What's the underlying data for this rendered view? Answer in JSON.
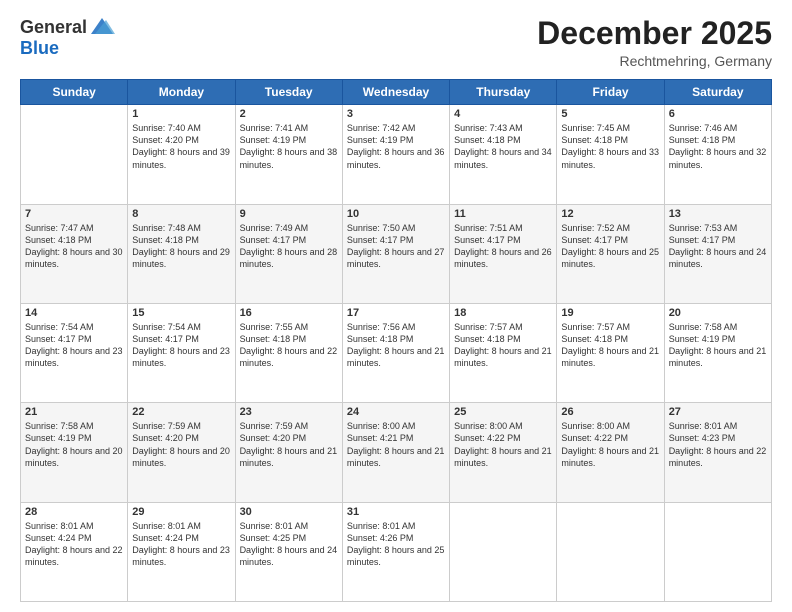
{
  "header": {
    "logo_general": "General",
    "logo_blue": "Blue",
    "month": "December 2025",
    "location": "Rechtmehring, Germany"
  },
  "days_of_week": [
    "Sunday",
    "Monday",
    "Tuesday",
    "Wednesday",
    "Thursday",
    "Friday",
    "Saturday"
  ],
  "weeks": [
    [
      {
        "day": "",
        "empty": true
      },
      {
        "day": "1",
        "sunrise": "Sunrise: 7:40 AM",
        "sunset": "Sunset: 4:20 PM",
        "daylight": "Daylight: 8 hours and 39 minutes."
      },
      {
        "day": "2",
        "sunrise": "Sunrise: 7:41 AM",
        "sunset": "Sunset: 4:19 PM",
        "daylight": "Daylight: 8 hours and 38 minutes."
      },
      {
        "day": "3",
        "sunrise": "Sunrise: 7:42 AM",
        "sunset": "Sunset: 4:19 PM",
        "daylight": "Daylight: 8 hours and 36 minutes."
      },
      {
        "day": "4",
        "sunrise": "Sunrise: 7:43 AM",
        "sunset": "Sunset: 4:18 PM",
        "daylight": "Daylight: 8 hours and 34 minutes."
      },
      {
        "day": "5",
        "sunrise": "Sunrise: 7:45 AM",
        "sunset": "Sunset: 4:18 PM",
        "daylight": "Daylight: 8 hours and 33 minutes."
      },
      {
        "day": "6",
        "sunrise": "Sunrise: 7:46 AM",
        "sunset": "Sunset: 4:18 PM",
        "daylight": "Daylight: 8 hours and 32 minutes."
      }
    ],
    [
      {
        "day": "7",
        "sunrise": "Sunrise: 7:47 AM",
        "sunset": "Sunset: 4:18 PM",
        "daylight": "Daylight: 8 hours and 30 minutes."
      },
      {
        "day": "8",
        "sunrise": "Sunrise: 7:48 AM",
        "sunset": "Sunset: 4:18 PM",
        "daylight": "Daylight: 8 hours and 29 minutes."
      },
      {
        "day": "9",
        "sunrise": "Sunrise: 7:49 AM",
        "sunset": "Sunset: 4:17 PM",
        "daylight": "Daylight: 8 hours and 28 minutes."
      },
      {
        "day": "10",
        "sunrise": "Sunrise: 7:50 AM",
        "sunset": "Sunset: 4:17 PM",
        "daylight": "Daylight: 8 hours and 27 minutes."
      },
      {
        "day": "11",
        "sunrise": "Sunrise: 7:51 AM",
        "sunset": "Sunset: 4:17 PM",
        "daylight": "Daylight: 8 hours and 26 minutes."
      },
      {
        "day": "12",
        "sunrise": "Sunrise: 7:52 AM",
        "sunset": "Sunset: 4:17 PM",
        "daylight": "Daylight: 8 hours and 25 minutes."
      },
      {
        "day": "13",
        "sunrise": "Sunrise: 7:53 AM",
        "sunset": "Sunset: 4:17 PM",
        "daylight": "Daylight: 8 hours and 24 minutes."
      }
    ],
    [
      {
        "day": "14",
        "sunrise": "Sunrise: 7:54 AM",
        "sunset": "Sunset: 4:17 PM",
        "daylight": "Daylight: 8 hours and 23 minutes."
      },
      {
        "day": "15",
        "sunrise": "Sunrise: 7:54 AM",
        "sunset": "Sunset: 4:17 PM",
        "daylight": "Daylight: 8 hours and 23 minutes."
      },
      {
        "day": "16",
        "sunrise": "Sunrise: 7:55 AM",
        "sunset": "Sunset: 4:18 PM",
        "daylight": "Daylight: 8 hours and 22 minutes."
      },
      {
        "day": "17",
        "sunrise": "Sunrise: 7:56 AM",
        "sunset": "Sunset: 4:18 PM",
        "daylight": "Daylight: 8 hours and 21 minutes."
      },
      {
        "day": "18",
        "sunrise": "Sunrise: 7:57 AM",
        "sunset": "Sunset: 4:18 PM",
        "daylight": "Daylight: 8 hours and 21 minutes."
      },
      {
        "day": "19",
        "sunrise": "Sunrise: 7:57 AM",
        "sunset": "Sunset: 4:18 PM",
        "daylight": "Daylight: 8 hours and 21 minutes."
      },
      {
        "day": "20",
        "sunrise": "Sunrise: 7:58 AM",
        "sunset": "Sunset: 4:19 PM",
        "daylight": "Daylight: 8 hours and 21 minutes."
      }
    ],
    [
      {
        "day": "21",
        "sunrise": "Sunrise: 7:58 AM",
        "sunset": "Sunset: 4:19 PM",
        "daylight": "Daylight: 8 hours and 20 minutes."
      },
      {
        "day": "22",
        "sunrise": "Sunrise: 7:59 AM",
        "sunset": "Sunset: 4:20 PM",
        "daylight": "Daylight: 8 hours and 20 minutes."
      },
      {
        "day": "23",
        "sunrise": "Sunrise: 7:59 AM",
        "sunset": "Sunset: 4:20 PM",
        "daylight": "Daylight: 8 hours and 21 minutes."
      },
      {
        "day": "24",
        "sunrise": "Sunrise: 8:00 AM",
        "sunset": "Sunset: 4:21 PM",
        "daylight": "Daylight: 8 hours and 21 minutes."
      },
      {
        "day": "25",
        "sunrise": "Sunrise: 8:00 AM",
        "sunset": "Sunset: 4:22 PM",
        "daylight": "Daylight: 8 hours and 21 minutes."
      },
      {
        "day": "26",
        "sunrise": "Sunrise: 8:00 AM",
        "sunset": "Sunset: 4:22 PM",
        "daylight": "Daylight: 8 hours and 21 minutes."
      },
      {
        "day": "27",
        "sunrise": "Sunrise: 8:01 AM",
        "sunset": "Sunset: 4:23 PM",
        "daylight": "Daylight: 8 hours and 22 minutes."
      }
    ],
    [
      {
        "day": "28",
        "sunrise": "Sunrise: 8:01 AM",
        "sunset": "Sunset: 4:24 PM",
        "daylight": "Daylight: 8 hours and 22 minutes."
      },
      {
        "day": "29",
        "sunrise": "Sunrise: 8:01 AM",
        "sunset": "Sunset: 4:24 PM",
        "daylight": "Daylight: 8 hours and 23 minutes."
      },
      {
        "day": "30",
        "sunrise": "Sunrise: 8:01 AM",
        "sunset": "Sunset: 4:25 PM",
        "daylight": "Daylight: 8 hours and 24 minutes."
      },
      {
        "day": "31",
        "sunrise": "Sunrise: 8:01 AM",
        "sunset": "Sunset: 4:26 PM",
        "daylight": "Daylight: 8 hours and 25 minutes."
      },
      {
        "day": "",
        "empty": true
      },
      {
        "day": "",
        "empty": true
      },
      {
        "day": "",
        "empty": true
      }
    ]
  ]
}
